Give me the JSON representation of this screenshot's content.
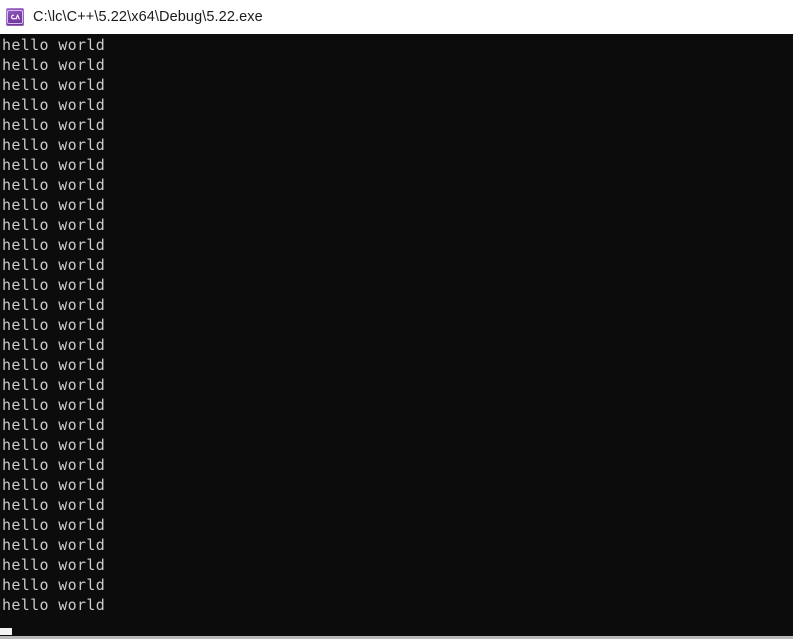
{
  "window": {
    "title": "C:\\lc\\C++\\5.22\\x64\\Debug\\5.22.exe",
    "icon_name": "cpp-console-app-icon",
    "titlebar_bg": "#ffffff",
    "titlebar_fg": "#1b1b1b"
  },
  "console": {
    "background": "#0c0c0c",
    "foreground": "#cccccc",
    "font_size_px": 15,
    "line_height_px": 20,
    "line_count": 29,
    "lines": [
      "hello world",
      "hello world",
      "hello world",
      "hello world",
      "hello world",
      "hello world",
      "hello world",
      "hello world",
      "hello world",
      "hello world",
      "hello world",
      "hello world",
      "hello world",
      "hello world",
      "hello world",
      "hello world",
      "hello world",
      "hello world",
      "hello world",
      "hello world",
      "hello world",
      "hello world",
      "hello world",
      "hello world",
      "hello world",
      "hello world",
      "hello world",
      "hello world",
      "hello world"
    ],
    "caret_color": "#f2f2f2"
  }
}
